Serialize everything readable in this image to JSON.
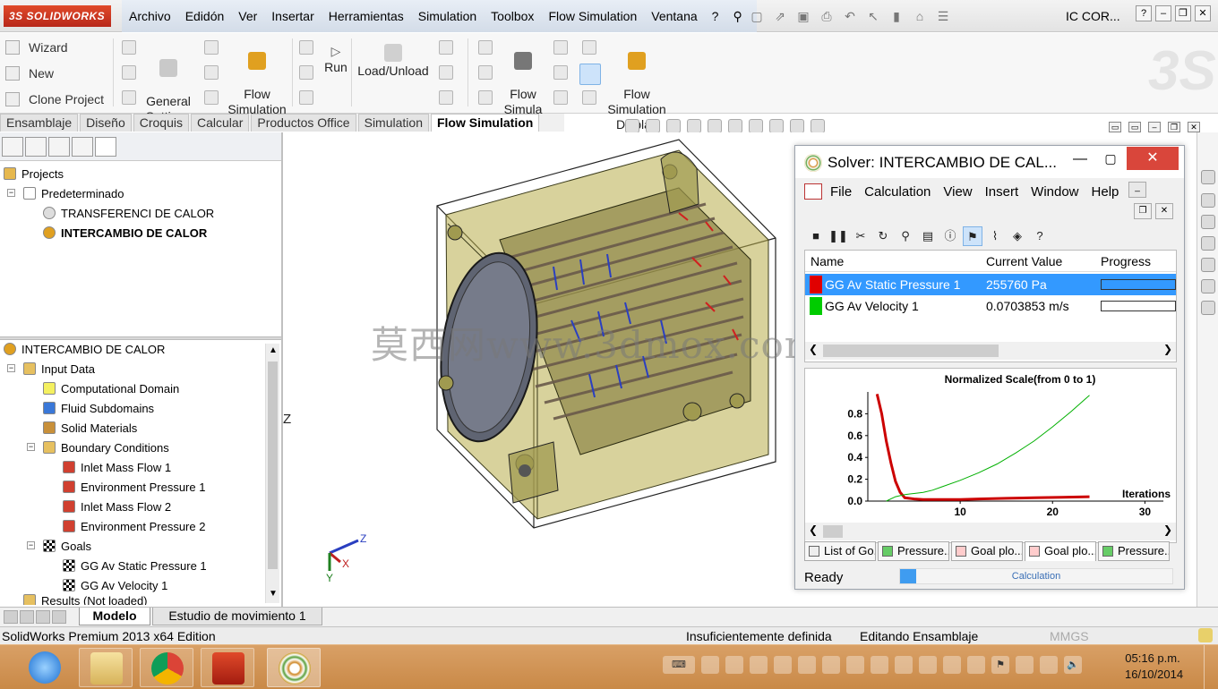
{
  "app": {
    "logo_text": "3S SOLIDWORKS",
    "menu": [
      "Archivo",
      "Edidón",
      "Ver",
      "Insertar",
      "Herramientas",
      "Simulation",
      "Toolbox",
      "Flow Simulation",
      "Ventana",
      "?"
    ],
    "doc_title": "IC COR..."
  },
  "command_manager": {
    "wizard": "Wizard",
    "new": "New",
    "clone_project": "Clone Project",
    "general_settings": "General\nSettings",
    "flow_simulation_features": "Flow\nSimulation\nFeatures",
    "run": "Run",
    "load_unload": "Load/Unload",
    "flow_simulation": "Flow\nSimula\ntion ...",
    "flow_simulation_display": "Flow\nSimulation\nDisplay"
  },
  "tabs": [
    "Ensamblaje",
    "Diseño",
    "Croquis",
    "Calcular",
    "Productos Office",
    "Simulation",
    "Flow Simulation"
  ],
  "active_tab": "Flow Simulation",
  "projects_tree": {
    "root": "Projects",
    "config": "Predeterminado",
    "items": [
      "TRANSFERENCI DE CALOR",
      "INTERCAMBIO DE CALOR"
    ]
  },
  "analysis_tree": {
    "root": "INTERCAMBIO DE CALOR",
    "input_data": "Input Data",
    "computational_domain": "Computational Domain",
    "fluid_subdomains": "Fluid Subdomains",
    "solid_materials": "Solid Materials",
    "boundary_conditions": "Boundary Conditions",
    "bc_items": [
      "Inlet Mass Flow 1",
      "Environment Pressure 1",
      "Inlet Mass Flow 2",
      "Environment Pressure 2"
    ],
    "goals": "Goals",
    "goal_items": [
      "GG Av Static Pressure 1",
      "GG Av Velocity 1"
    ],
    "results": "Results (Not loaded)"
  },
  "model_tabs": [
    "Modelo",
    "Estudio de movimiento 1"
  ],
  "statusbar": {
    "edition": "SolidWorks Premium 2013 x64 Edition",
    "status1": "Insuficientemente definida",
    "status2": "Editando Ensamblaje",
    "units": "MMGS"
  },
  "watermark": "莫西网www.3dmox.com",
  "view_axis_label": "Z",
  "triad": {
    "z": "Z",
    "x": "X",
    "y": "Y"
  },
  "solver": {
    "title": "Solver: INTERCAMBIO DE CAL...",
    "menu": [
      "File",
      "Calculation",
      "View",
      "Insert",
      "Window",
      "Help"
    ],
    "columns": [
      "Name",
      "Current Value",
      "Progress"
    ],
    "goals": [
      {
        "name": "GG Av Static Pressure 1",
        "value": "255760 Pa",
        "color": "#e00000",
        "progress": 1.0
      },
      {
        "name": "GG Av Velocity 1",
        "value": "0.0703853 m/s",
        "color": "#00cc00",
        "progress": 0.0
      }
    ],
    "bottom_tabs": [
      "List of Go...",
      "Pressure...",
      "Goal plo...",
      "Goal plo...",
      "Pressure..."
    ],
    "status": "Ready",
    "status_bar_label": "Calculation",
    "status_progress": 0.06
  },
  "chart_data": {
    "type": "line",
    "title": "Normalized Scale(from 0 to 1)",
    "xlabel": "Iterations",
    "ylabel": "",
    "xlim": [
      0,
      32
    ],
    "ylim": [
      0,
      1
    ],
    "xticks": [
      10,
      20,
      30
    ],
    "yticks": [
      0.0,
      0.2,
      0.4,
      0.6,
      0.8
    ],
    "series": [
      {
        "color": "#cc0000",
        "x": [
          1,
          1.5,
          2,
          2.5,
          3,
          3.5,
          4,
          5,
          6,
          8,
          10,
          12,
          15,
          18,
          21,
          24
        ],
        "y": [
          0.98,
          0.8,
          0.55,
          0.35,
          0.18,
          0.08,
          0.03,
          0.02,
          0.015,
          0.015,
          0.015,
          0.02,
          0.025,
          0.03,
          0.035,
          0.04
        ]
      },
      {
        "color": "#00b000",
        "x": [
          2,
          3,
          4,
          5,
          6,
          7,
          8,
          10,
          12,
          14,
          16,
          18,
          20,
          22,
          24
        ],
        "y": [
          0.0,
          0.04,
          0.06,
          0.07,
          0.08,
          0.1,
          0.13,
          0.19,
          0.26,
          0.34,
          0.44,
          0.55,
          0.68,
          0.82,
          0.97
        ]
      }
    ]
  },
  "taskbar": {
    "time": "05:16 p.m.",
    "date": "16/10/2014"
  }
}
